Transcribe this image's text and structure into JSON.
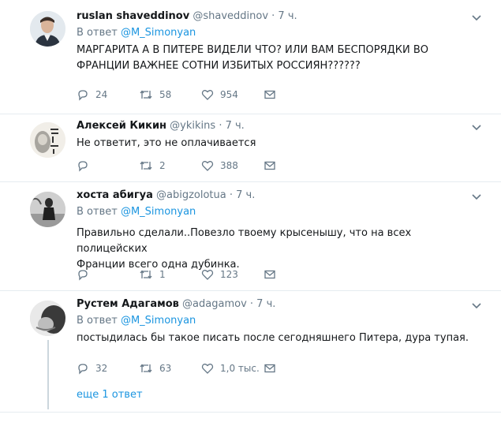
{
  "tweets": [
    {
      "name": "ruslan shaveddinov",
      "handle": "@shaveddinov",
      "time": "· 7 ч.",
      "reply_prefix": "В ответ",
      "reply_to": "@M_Simonyan",
      "text_lines": [
        "МАРГАРИТА А В ПИТЕРЕ ВИДЕЛИ ЧТО? ИЛИ ВАМ БЕСПОРЯДКИ ВО",
        "ФРАНЦИИ ВАЖНЕЕ СОТНИ ИЗБИТЫХ РОССИЯН??????"
      ],
      "replies": "24",
      "retweets": "58",
      "likes": "954"
    },
    {
      "name": "Алексей Кикин",
      "handle": "@ykikins",
      "time": "· 7 ч.",
      "text_lines": [
        "Не ответит, это не оплачивается"
      ],
      "replies": "",
      "retweets": "2",
      "likes": "388"
    },
    {
      "name": "хоста абигуа",
      "handle": "@abigzolotua",
      "time": "· 7 ч.",
      "reply_prefix": "В ответ",
      "reply_to": "@M_Simonyan",
      "text_lines": [
        "Правильно сделали..Повезло твоему крысенышу, что на всех полицейских",
        "Франции  всего одна дубинка."
      ],
      "replies": "",
      "retweets": "1",
      "likes": "123"
    },
    {
      "name": "Рустем Адагамов",
      "handle": "@adagamov",
      "time": "· 7 ч.",
      "reply_prefix": "В ответ",
      "reply_to": "@M_Simonyan",
      "text_lines": [
        "постыдилась бы такое писать после сегодняшнего Питера, дура тупая."
      ],
      "replies": "32",
      "retweets": "63",
      "likes": "1,0 тыс."
    }
  ],
  "show_more": "еще 1 ответ",
  "colors": {
    "link": "#1b95e0",
    "muted": "#657786",
    "divider": "#e6ecf0"
  }
}
